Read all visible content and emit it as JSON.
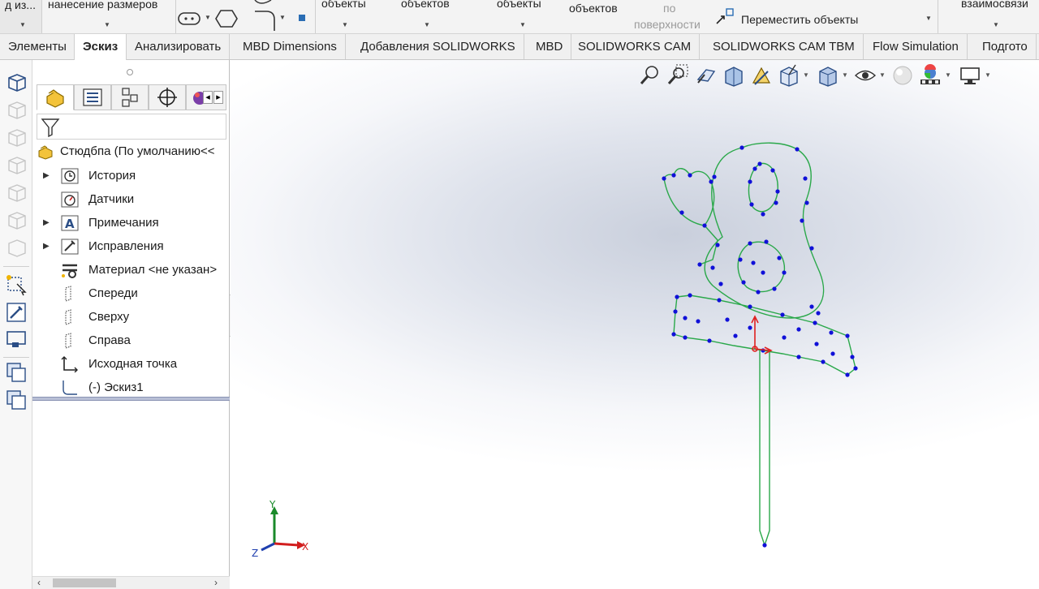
{
  "ribbon": {
    "item1": "д из...",
    "item2": "нанесение размеров",
    "item3": "объекты",
    "item4": "объектов",
    "item5": "объекты",
    "item6": "объектов",
    "item7_line1": "по",
    "item7_line2": "поверхности",
    "move_label": "Переместить объекты",
    "item_right": "взаимосвязи"
  },
  "tabs": [
    {
      "label": "Элементы"
    },
    {
      "label": "Эскиз",
      "active": true
    },
    {
      "label": "Анализировать"
    },
    {
      "label": "MBD Dimensions"
    },
    {
      "label": "Добавления SOLIDWORKS"
    },
    {
      "label": "MBD"
    },
    {
      "label": "SOLIDWORKS CAM"
    },
    {
      "label": "SOLIDWORKS CAM TBM"
    },
    {
      "label": "Flow Simulation"
    },
    {
      "label": "Подгото"
    }
  ],
  "tree": {
    "root": "Стюдбпа  (По умолчанию<<",
    "items": [
      {
        "label": "История",
        "icon": "history-icon",
        "expandable": true
      },
      {
        "label": "Датчики",
        "icon": "sensors-icon",
        "expandable": false
      },
      {
        "label": "Примечания",
        "icon": "annotations-icon",
        "expandable": true
      },
      {
        "label": "Исправления",
        "icon": "fixes-icon",
        "expandable": true
      },
      {
        "label": "Материал <не указан>",
        "icon": "material-icon",
        "expandable": false
      },
      {
        "label": "Спереди",
        "icon": "plane-icon",
        "expandable": false
      },
      {
        "label": "Сверху",
        "icon": "plane-icon",
        "expandable": false
      },
      {
        "label": "Справа",
        "icon": "plane-icon",
        "expandable": false
      },
      {
        "label": "Исходная точка",
        "icon": "origin-icon",
        "expandable": false
      },
      {
        "label": "(-) Эскиз1",
        "icon": "sketch-icon",
        "expandable": false
      }
    ]
  },
  "triad": {
    "x": "X",
    "y": "Y",
    "z": "Z"
  },
  "colors": {
    "sketch_line": "#2aa84a",
    "sketch_point": "#1010d8",
    "accent": "#1f5fb0"
  }
}
